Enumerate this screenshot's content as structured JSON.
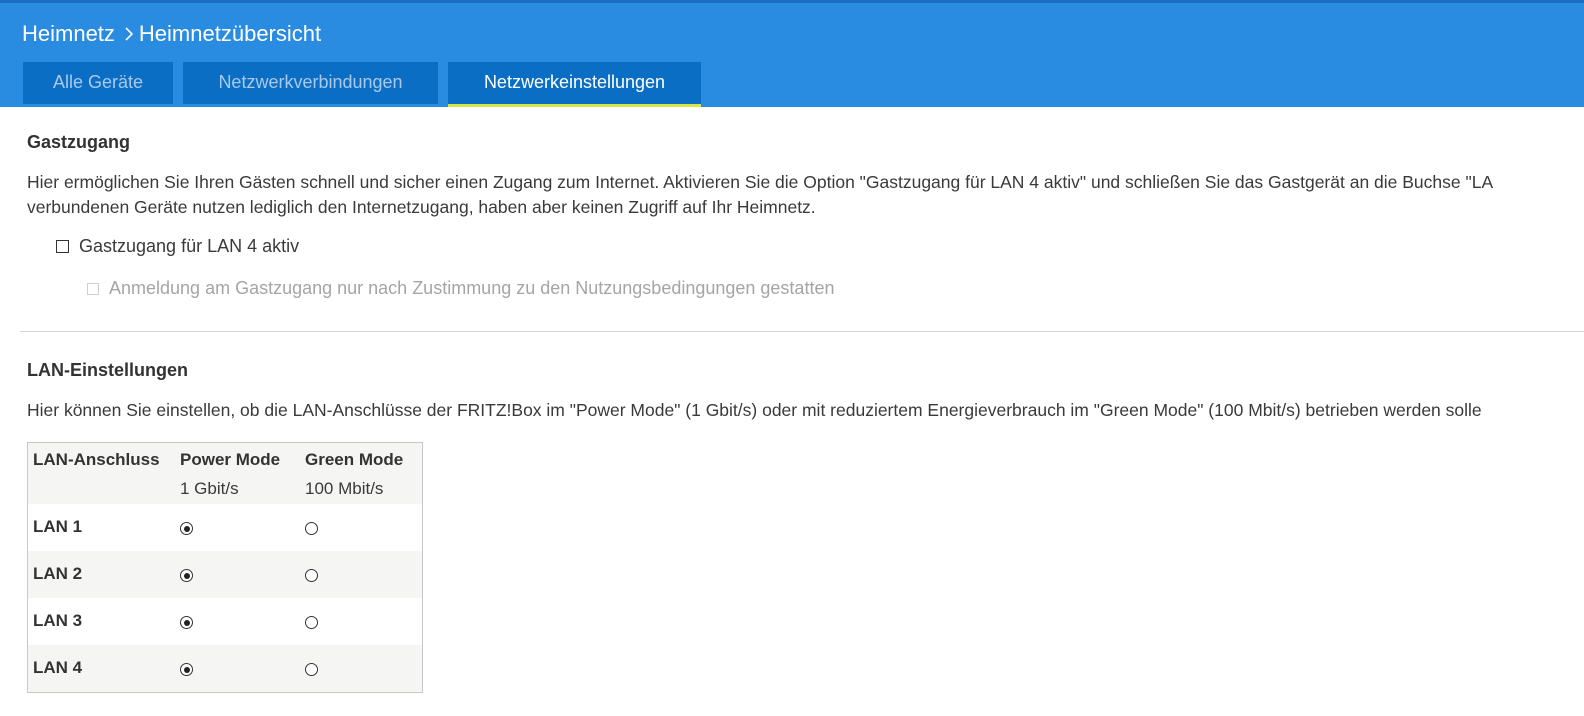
{
  "breadcrumb": {
    "parent": "Heimnetz",
    "current": "Heimnetzübersicht"
  },
  "tabs": [
    {
      "label": "Alle Geräte",
      "active": false
    },
    {
      "label": "Netzwerkverbindungen",
      "active": false
    },
    {
      "label": "Netzwerkeinstellungen",
      "active": true
    }
  ],
  "guest": {
    "title": "Gastzugang",
    "desc_line1": "Hier ermöglichen Sie Ihren Gästen schnell und sicher einen Zugang zum Internet. Aktivieren Sie die Option \"Gastzugang für LAN 4 aktiv\" und schließen Sie das Gastgerät an die Buchse \"LA",
    "desc_line2": "verbundenen Geräte nutzen lediglich den Internetzugang, haben aber keinen Zugriff auf Ihr Heimnetz.",
    "option_active": {
      "label": "Gastzugang für LAN 4 aktiv",
      "checked": false
    },
    "option_terms": {
      "label": "Anmeldung am Gastzugang nur nach Zustimmung zu den Nutzungsbedingungen gestatten",
      "checked": false,
      "disabled": true
    }
  },
  "lan": {
    "title": "LAN-Einstellungen",
    "desc": "Hier können Sie einstellen, ob die LAN-Anschlüsse der FRITZ!Box im \"Power Mode\" (1 Gbit/s) oder mit reduziertem Energieverbrauch im \"Green Mode\" (100 Mbit/s) betrieben werden solle",
    "table": {
      "col_port": "LAN-Anschluss",
      "col_power": "Power Mode",
      "col_power_sub": "1 Gbit/s",
      "col_green": "Green Mode",
      "col_green_sub": "100 Mbit/s",
      "rows": [
        {
          "port": "LAN 1",
          "mode": "power"
        },
        {
          "port": "LAN 2",
          "mode": "power"
        },
        {
          "port": "LAN 3",
          "mode": "power"
        },
        {
          "port": "LAN 4",
          "mode": "power"
        }
      ]
    }
  },
  "colors": {
    "header_bg": "#2a8ce0",
    "tab_bg": "#0b6ec5",
    "tab_active_underline": "#d6e64a"
  }
}
